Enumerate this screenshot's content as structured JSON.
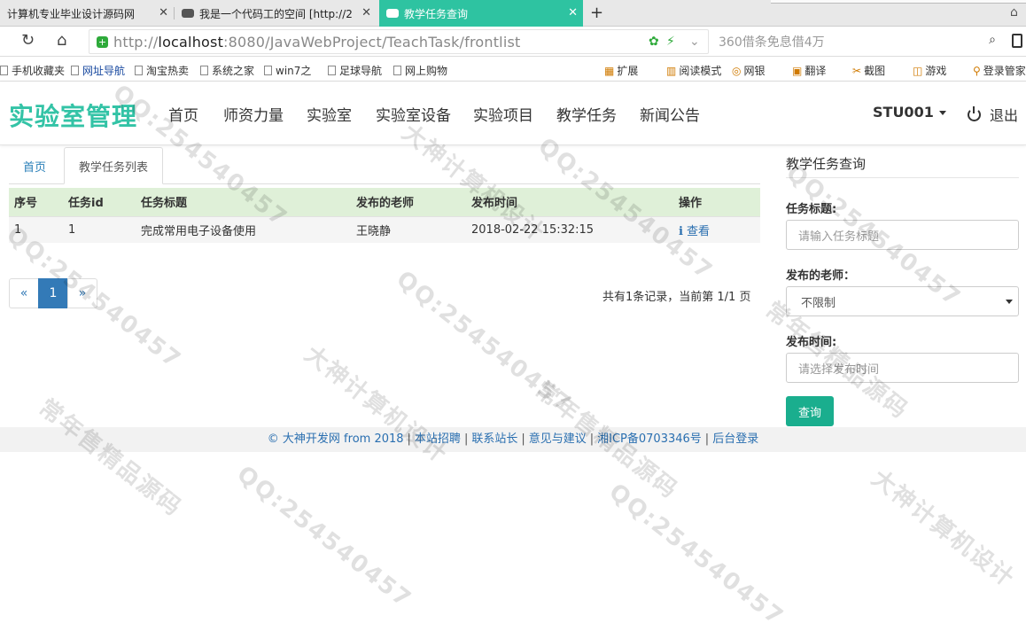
{
  "browser": {
    "tabs": [
      {
        "title": "计算机专业毕业设计源码网"
      },
      {
        "title": "我是一个代码工的空间 [http://2"
      },
      {
        "title": "教学任务查询"
      }
    ],
    "url_prefix": "http://",
    "url_host": "localhost",
    "url_rest": ":8080/JavaWebProject/TeachTask/frontlist",
    "search_placeholder": "360借条免息借4万",
    "bookmarks": [
      "手机收藏夹",
      "网址导航",
      "淘宝热卖",
      "系统之家",
      "win7之",
      "足球导航",
      "网上购物"
    ],
    "toolbar_items": [
      "扩展",
      "阅读模式",
      "网银",
      "翻译",
      "截图",
      "游戏",
      "登录管家"
    ]
  },
  "nav": {
    "brand": "实验室管理",
    "items": [
      "首页",
      "师资力量",
      "实验室",
      "实验室设备",
      "实验项目",
      "教学任务",
      "新闻公告"
    ],
    "user": "STU001",
    "logout": "退出"
  },
  "tabs": {
    "home": "首页",
    "active": "教学任务列表"
  },
  "table": {
    "headers": [
      "序号",
      "任务id",
      "任务标题",
      "发布的老师",
      "发布时间",
      "操作"
    ],
    "rows": [
      {
        "seq": "1",
        "id": "1",
        "title": "完成常用电子设备使用",
        "teacher": "王晓静",
        "time": "2018-02-22 15:32:15",
        "action": "查看"
      }
    ]
  },
  "pager": {
    "prev": "«",
    "current": "1",
    "next": "»",
    "info": "共有1条记录，当前第 1/1 页"
  },
  "search": {
    "title": "教学任务查询",
    "task_title_label": "任务标题:",
    "task_title_placeholder": "请输入任务标题",
    "teacher_label": "发布的老师：",
    "teacher_value": "不限制",
    "time_label": "发布时间:",
    "time_placeholder": "请选择发布时间",
    "submit": "查询"
  },
  "footer": {
    "copyright": "© 大神开发网 from 2018",
    "links": [
      "本站招聘",
      "联系站长",
      "意见与建议",
      "湘ICP备0703346号",
      "后台登录"
    ]
  },
  "watermark": {
    "texts": [
      "大神计算机设计",
      "QQ:254540457",
      "常年售精品源码"
    ]
  },
  "colors": {
    "brand": "#33c3a6",
    "active_tab": "#2ec3a1",
    "table_header": "#dff0d8",
    "pager_active": "#337ab7",
    "query_button": "#1aae8e",
    "link": "#2a6fb0"
  }
}
